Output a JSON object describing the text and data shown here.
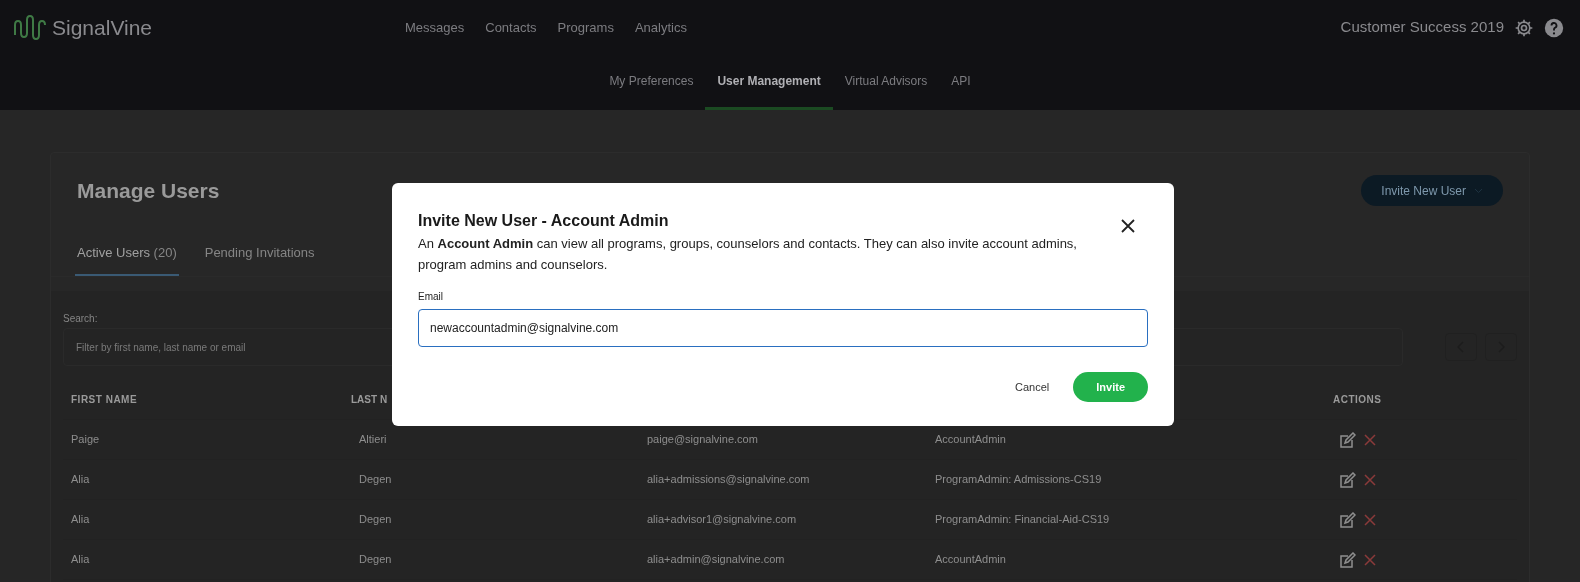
{
  "header": {
    "logo": "SignalVine",
    "nav": [
      {
        "label": "Messages"
      },
      {
        "label": "Contacts"
      },
      {
        "label": "Programs"
      },
      {
        "label": "Analytics"
      }
    ],
    "account": "Customer Success 2019",
    "subnav": [
      {
        "label": "My Preferences",
        "selected": false
      },
      {
        "label": "User Management",
        "selected": true
      },
      {
        "label": "Virtual Advisors",
        "selected": false
      },
      {
        "label": "API",
        "selected": false
      }
    ]
  },
  "page": {
    "title": "Manage Users",
    "invite_button": "Invite New User",
    "tabs": [
      {
        "label": "Active Users",
        "count": "(20)",
        "selected": true
      },
      {
        "label": "Pending Invitations",
        "selected": false
      }
    ],
    "search": {
      "label": "Search:",
      "placeholder": "Filter by first name, last name or email"
    },
    "table": {
      "columns": [
        "FIRST NAME",
        "LAST N",
        "ACTIONS"
      ],
      "rows": [
        {
          "first_name": "Paige",
          "last_name": "Altieri",
          "email": "paige@signalvine.com",
          "role": "AccountAdmin"
        },
        {
          "first_name": "Alia",
          "last_name": "Degen",
          "email": "alia+admissions@signalvine.com",
          "role": "ProgramAdmin: Admissions-CS19"
        },
        {
          "first_name": "Alia",
          "last_name": "Degen",
          "email": "alia+advisor1@signalvine.com",
          "role": "ProgramAdmin: Financial-Aid-CS19"
        },
        {
          "first_name": "Alia",
          "last_name": "Degen",
          "email": "alia+admin@signalvine.com",
          "role": "AccountAdmin"
        }
      ]
    }
  },
  "dialog": {
    "title": "Invite New User - Account Admin",
    "description": "An **Account Admin** can view all programs, groups, counselors and contacts. They can also invite account admins, program admins and counselors.",
    "email_label": "Email",
    "email_value": "newaccountadmin@signalvine.com",
    "cancel": "Cancel",
    "invite": "Invite"
  }
}
